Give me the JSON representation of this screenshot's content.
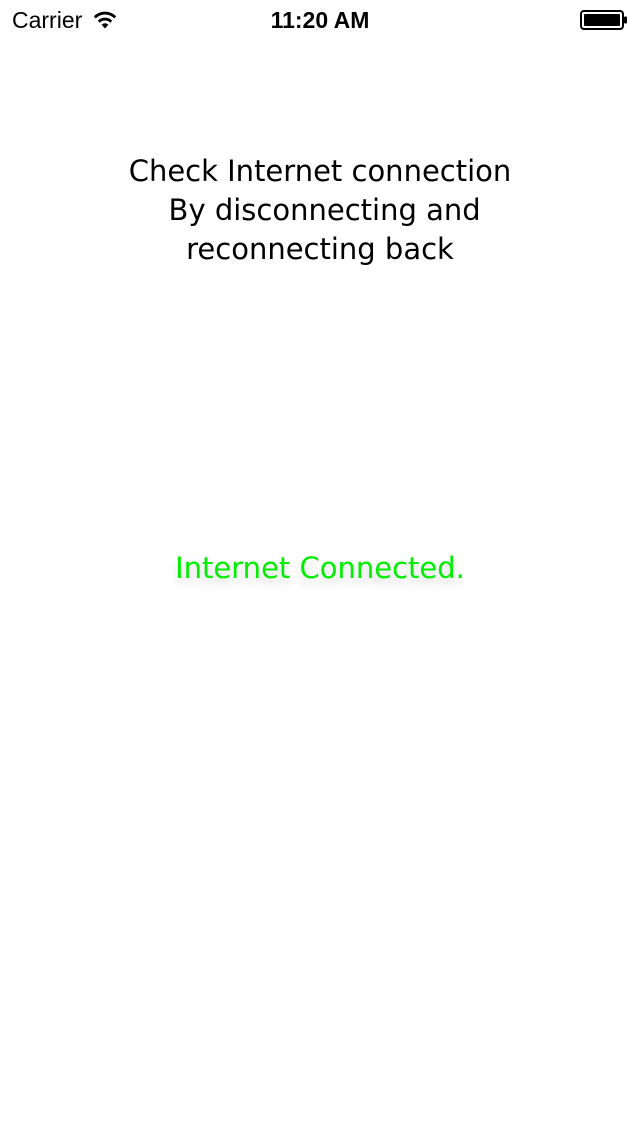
{
  "status_bar": {
    "carrier": "Carrier",
    "time": "11:20 AM",
    "icons": [
      "wifi-icon",
      "battery-icon"
    ]
  },
  "instructions": {
    "lines": [
      "Check Internet connection",
      " By disconnecting and",
      "reconnecting back"
    ]
  },
  "connection_status": {
    "text": "Internet Connected.",
    "color": "#00ee00"
  }
}
